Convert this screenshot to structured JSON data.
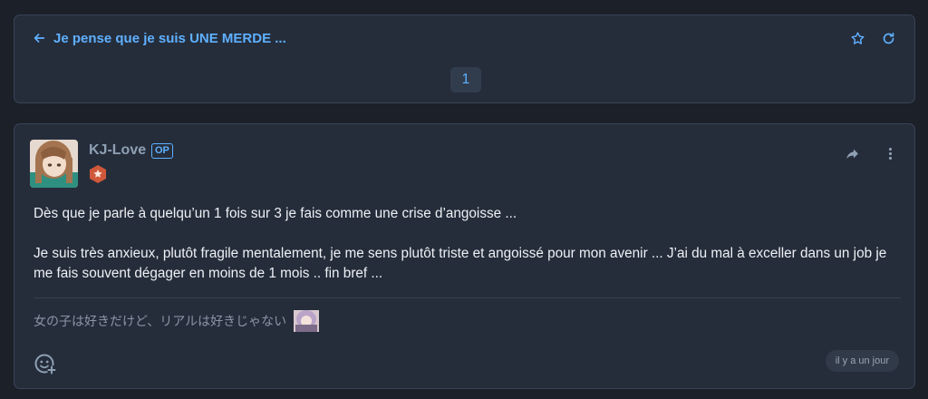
{
  "topic": {
    "title": "Je pense que je suis UNE MERDE ...",
    "icons": {
      "back": "arrow-left-icon",
      "favorite": "star-icon",
      "refresh": "refresh-icon"
    },
    "pagination": {
      "current_page": "1"
    }
  },
  "post": {
    "author": "KJ-Love",
    "op_badge": "OP",
    "paragraphs": [
      "Dès que je parle à quelqu’un 1 fois sur 3 je fais comme une crise d’angoisse ...",
      "Je suis très anxieux, plutôt fragile mentalement, je me sens plutôt triste et angoissé pour mon avenir ... J’ai du mal à exceller dans un job je me fais souvent dégager en moins de 1 mois .. fin bref ..."
    ],
    "signature": "女の子は好きだけど、リアルは好きじゃない",
    "date": "il y a un jour",
    "icons": {
      "share": "share-icon",
      "more": "more-vertical-icon",
      "react": "add-reaction-icon",
      "rank": "rank-badge-icon"
    }
  },
  "colors": {
    "accent": "#5fb0ff",
    "card": "#252d3b",
    "background": "#1b2029",
    "rank_badge": "#d0583a"
  }
}
